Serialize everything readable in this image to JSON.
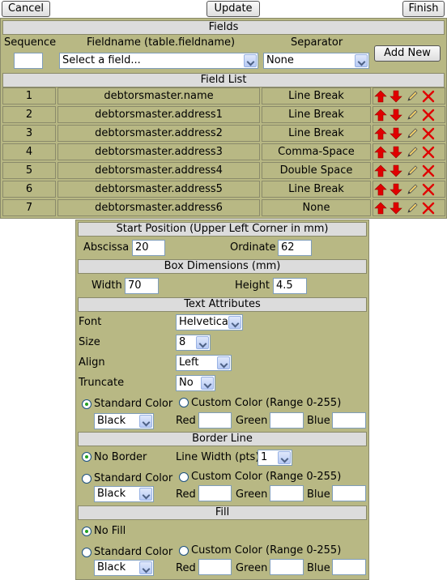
{
  "toolbar": {
    "cancel": "Cancel",
    "update": "Update",
    "finish": "Finish"
  },
  "fields": {
    "title": "Fields",
    "col_sequence": "Sequence",
    "col_fieldname": "Fieldname (table.fieldname)",
    "col_separator": "Separator",
    "sequence_value": "",
    "fieldname_select": "Select a field...",
    "separator_select": "None",
    "add_new": "Add New"
  },
  "field_list": {
    "title": "Field List",
    "rows": [
      {
        "seq": "1",
        "name": "debtorsmaster.name",
        "sep": "Line Break"
      },
      {
        "seq": "2",
        "name": "debtorsmaster.address1",
        "sep": "Line Break"
      },
      {
        "seq": "3",
        "name": "debtorsmaster.address2",
        "sep": "Line Break"
      },
      {
        "seq": "4",
        "name": "debtorsmaster.address3",
        "sep": "Comma-Space"
      },
      {
        "seq": "5",
        "name": "debtorsmaster.address4",
        "sep": "Double Space"
      },
      {
        "seq": "6",
        "name": "debtorsmaster.address5",
        "sep": "Line Break"
      },
      {
        "seq": "7",
        "name": "debtorsmaster.address6",
        "sep": "None"
      }
    ]
  },
  "start_position": {
    "title": "Start Position (Upper Left Corner in mm)",
    "abscissa_label": "Abscissa",
    "abscissa": "20",
    "ordinate_label": "Ordinate",
    "ordinate": "62"
  },
  "box_dimensions": {
    "title": "Box Dimensions (mm)",
    "width_label": "Width",
    "width": "70",
    "height_label": "Height",
    "height": "4.5"
  },
  "text_attributes": {
    "title": "Text Attributes",
    "font_label": "Font",
    "font": "Helvetica",
    "size_label": "Size",
    "size": "8",
    "align_label": "Align",
    "align": "Left",
    "truncate_label": "Truncate",
    "truncate": "No",
    "standard_color": "Standard Color",
    "standard_value": "Black",
    "custom_color": "Custom Color (Range 0-255)",
    "red": "Red",
    "green": "Green",
    "blue": "Blue"
  },
  "border_line": {
    "title": "Border Line",
    "no_border": "No Border",
    "line_width_label": "Line Width (pts)",
    "line_width": "1",
    "standard_color": "Standard Color",
    "standard_value": "Black",
    "custom_color": "Custom Color (Range 0-255)",
    "red": "Red",
    "green": "Green",
    "blue": "Blue"
  },
  "fill": {
    "title": "Fill",
    "no_fill": "No Fill",
    "standard_color": "Standard Color",
    "standard_value": "Black",
    "custom_color": "Custom Color (Range 0-255)",
    "red": "Red",
    "green": "Green",
    "blue": "Blue"
  },
  "colors": {
    "panel": "#b8b884",
    "header": "#dcdcdc",
    "arrow": "#e00000",
    "delete": "#e00000"
  }
}
